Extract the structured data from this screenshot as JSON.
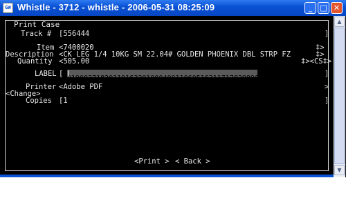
{
  "window": {
    "title": "Whistle - 3712 - whistle - 2006-05-31 08:25:09",
    "icon_label": "GW",
    "minimize_icon": "minimize-icon",
    "maximize_icon": "maximize-icon",
    "close_icon": "close-icon",
    "minimize_glyph": "_",
    "maximize_glyph": "□",
    "close_glyph": "✕"
  },
  "form": {
    "section_title": "Print Case",
    "track": {
      "label": "Track #",
      "value": "[556444",
      "end": "]"
    },
    "item": {
      "label": "Item",
      "value": "<7400020",
      "end": "‡>"
    },
    "description": {
      "label": "Description",
      "value": "<CK LEG 1/4 10KG SM 22.04# GOLDEN PHOENIX DBL STRP FZ",
      "end": "‡>"
    },
    "quantity": {
      "label": "Quantity",
      "value": "<505.00",
      "end": "‡><CS‡>"
    },
    "label_field": {
      "label": "LABEL",
      "open": "[",
      "value": "01900271820119163201000400110605162117178298965",
      "end": "]"
    },
    "printer": {
      "label": "Printer",
      "value": "<Adobe PDF",
      "end": ">"
    },
    "change": {
      "label": "<Change>"
    },
    "copies": {
      "label": "Copies",
      "value": "[1",
      "end": "]"
    }
  },
  "actions": {
    "print_label": "<Print >",
    "back_label": "< Back >"
  },
  "scroll": {
    "up_icon": "scroll-up-icon",
    "down_icon": "scroll-down-icon",
    "up_glyph": "▲",
    "down_glyph": "▼"
  }
}
